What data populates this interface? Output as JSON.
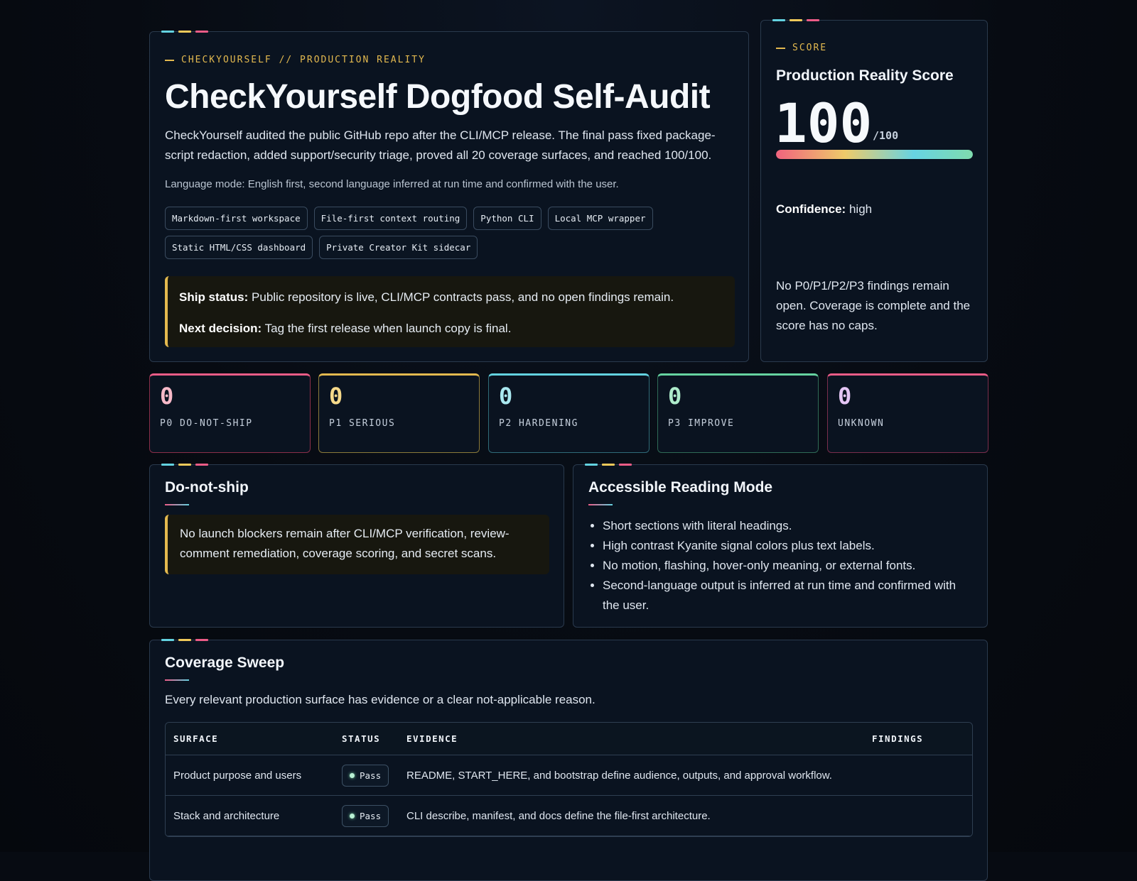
{
  "hero": {
    "eyebrow": "CHECKYOURSELF // PRODUCTION REALITY",
    "title": "CheckYourself Dogfood Self-Audit",
    "description": "CheckYourself audited the public GitHub repo after the CLI/MCP release. The final pass fixed package-script redaction, added support/security triage, proved all 20 coverage surfaces, and reached 100/100.",
    "language_note": "Language mode: English first, second language inferred at run time and confirmed with the user.",
    "tags": [
      "Markdown-first workspace",
      "File-first context routing",
      "Python CLI",
      "Local MCP wrapper",
      "Static HTML/CSS dashboard",
      "Private Creator Kit sidecar"
    ],
    "ship_status_label": "Ship status:",
    "ship_status_text": "Public repository is live, CLI/MCP contracts pass, and no open findings remain.",
    "next_decision_label": "Next decision:",
    "next_decision_text": "Tag the first release when launch copy is final."
  },
  "score": {
    "eyebrow": "SCORE",
    "title": "Production Reality Score",
    "value": "100",
    "max": "/100",
    "fraction": 1.0,
    "confidence_label": "Confidence:",
    "confidence_value": "high",
    "note": "No P0/P1/P2/P3 findings remain open. Coverage is complete and the score has no caps."
  },
  "stats": {
    "p0": {
      "value": "0",
      "label": "P0 DO-NOT-SHIP"
    },
    "p1": {
      "value": "0",
      "label": "P1 SERIOUS"
    },
    "p2": {
      "value": "0",
      "label": "P2 HARDENING"
    },
    "p3": {
      "value": "0",
      "label": "P3 IMPROVE"
    },
    "unknown": {
      "value": "0",
      "label": "UNKNOWN"
    }
  },
  "do_not_ship": {
    "title": "Do-not-ship",
    "text": "No launch blockers remain after CLI/MCP verification, review-comment remediation, coverage scoring, and secret scans."
  },
  "reading_mode": {
    "title": "Accessible Reading Mode",
    "items": [
      "Short sections with literal headings.",
      "High contrast Kyanite signal colors plus text labels.",
      "No motion, flashing, hover-only meaning, or external fonts.",
      "Second-language output is inferred at run time and confirmed with the user."
    ]
  },
  "coverage": {
    "title": "Coverage Sweep",
    "subtitle": "Every relevant production surface has evidence or a clear not-applicable reason.",
    "headers": {
      "surface": "SURFACE",
      "status": "STATUS",
      "evidence": "EVIDENCE",
      "findings": "FINDINGS"
    },
    "rows": [
      {
        "surface": "Product purpose and users",
        "status": "Pass",
        "evidence": "README, START_HERE, and bootstrap define audience, outputs, and approval workflow.",
        "findings": ""
      },
      {
        "surface": "Stack and architecture",
        "status": "Pass",
        "evidence": "CLI describe, manifest, and docs define the file-first architecture.",
        "findings": ""
      }
    ]
  },
  "colors": {
    "accent_cyan": "#63d2e0",
    "accent_gold": "#e3b94f",
    "accent_pink": "#ec5c87",
    "accent_green": "#66d3a0",
    "background": "#070b12",
    "card": "#0a1320"
  }
}
